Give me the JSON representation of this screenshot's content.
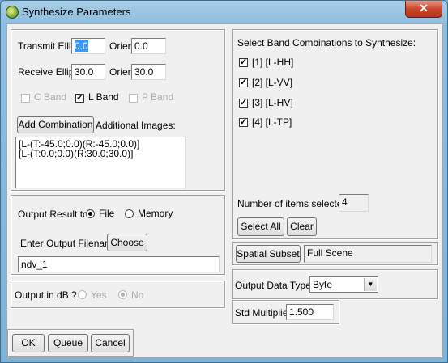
{
  "window": {
    "title": "Synthesize Parameters",
    "close_symbol": "✕"
  },
  "transmit": {
    "label": "Transmit Ellip",
    "ellip": "0.0",
    "orien_label": "Orien",
    "orien": "0.0"
  },
  "receive": {
    "label": "Receive Ellip",
    "ellip": "30.0",
    "orien_label": "Orien",
    "orien": "30.0"
  },
  "bands": {
    "c": {
      "label": "C Band",
      "checked": false,
      "enabled": false
    },
    "l": {
      "label": "L Band",
      "checked": true,
      "enabled": true
    },
    "p": {
      "label": "P Band",
      "checked": false,
      "enabled": false
    }
  },
  "add_combination": {
    "button": "Add Combination",
    "label": "Additional Images:"
  },
  "additional_images": [
    "[L-(T:-45.0;0.0)(R:-45.0;0.0)]",
    "[L-(T:0.0;0.0)(R:30.0;30.0)]"
  ],
  "output": {
    "label": "Output Result to",
    "file_label": "File",
    "memory_label": "Memory",
    "selected": "File",
    "filename_label": "Enter Output Filename",
    "choose_button": "Choose",
    "filename": "ndv_1"
  },
  "db": {
    "label": "Output in dB ?",
    "yes": "Yes",
    "no": "No",
    "selected": "No"
  },
  "bottom_buttons": {
    "ok": "OK",
    "queue": "Queue",
    "cancel": "Cancel"
  },
  "band_combinations": {
    "heading": "Select Band Combinations to Synthesize:",
    "items": [
      {
        "label": "[1] [L-HH]",
        "checked": true
      },
      {
        "label": "[2] [L-VV]",
        "checked": true
      },
      {
        "label": "[3] [L-HV]",
        "checked": true
      },
      {
        "label": "[4] [L-TP]",
        "checked": true
      }
    ],
    "count_label": "Number of items selected:",
    "count": "4",
    "select_all": "Select All",
    "clear": "Clear"
  },
  "spatial": {
    "button": "Spatial Subset",
    "value": "Full Scene"
  },
  "data_type": {
    "label": "Output Data Type",
    "value": "Byte"
  },
  "std": {
    "label": "Std Multiplier",
    "value": "1.500"
  },
  "icons": {
    "app": "envi-globe-icon",
    "close": "close-icon",
    "check": "✓",
    "dropdown": "▼"
  }
}
